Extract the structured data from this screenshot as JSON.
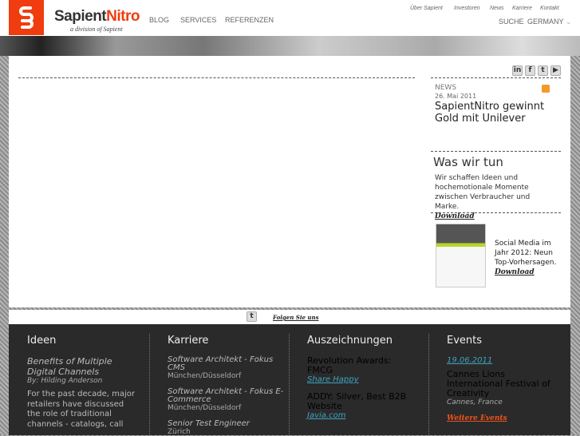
{
  "header": {
    "brand_a": "Sapient",
    "brand_b": "Nitro",
    "tagline": "a division of Sapient",
    "nav": [
      "BLOG",
      "SERVICES",
      "REFERENZEN"
    ],
    "utility": [
      "Über Sapient",
      "Investoren",
      "News",
      "Karriere",
      "Kontakt"
    ],
    "search": "SUCHE",
    "country": "GERMANY"
  },
  "social": {
    "icons": [
      "in",
      "f",
      "t",
      "▶"
    ]
  },
  "news": {
    "label": "NEWS",
    "date": "26. Mai 2011",
    "title": "SapientNitro gewinnt Gold mit Unilever"
  },
  "was": {
    "title": "Was wir tun",
    "text": "Wir schaffen Ideen und hochemotionale Momente zwischen Verbraucher und Marke.",
    "download": "Download"
  },
  "social_media": {
    "text": "Social Media im Jahr 2012: Neun Top-Vorhersagen.",
    "download": "Download"
  },
  "follow": {
    "label": "Folgen Sie uns"
  },
  "footer": {
    "ideen": {
      "title": "Ideen",
      "article": "Benefits of Multiple Digital Channels",
      "author": "By: Hilding Anderson",
      "text": "For the past decade, major retailers have discussed the role of traditional channels - catalogs, call"
    },
    "karriere": {
      "title": "Karriere",
      "jobs": [
        {
          "title": "Software Architekt - Fokus CMS",
          "loc": "München/Düsseldorf"
        },
        {
          "title": "Software Architekt - Fokus E-Commerce",
          "loc": "München/Düsseldorf"
        },
        {
          "title": "Senior Test Engineer",
          "loc": "Zürich"
        }
      ]
    },
    "awards": {
      "title": "Auszeichnungen",
      "items": [
        {
          "name": "Revolution Awards: FMCG",
          "link": "Share Happy"
        },
        {
          "name": "ADDY: Silver, Best B2B Website",
          "link": "Javia.com"
        }
      ]
    },
    "events": {
      "title": "Events",
      "date": "19.06.2011",
      "name": "Cannes Lions International Festival of Creativity",
      "place": "Cannes, France",
      "more": "Weitere Events"
    }
  }
}
